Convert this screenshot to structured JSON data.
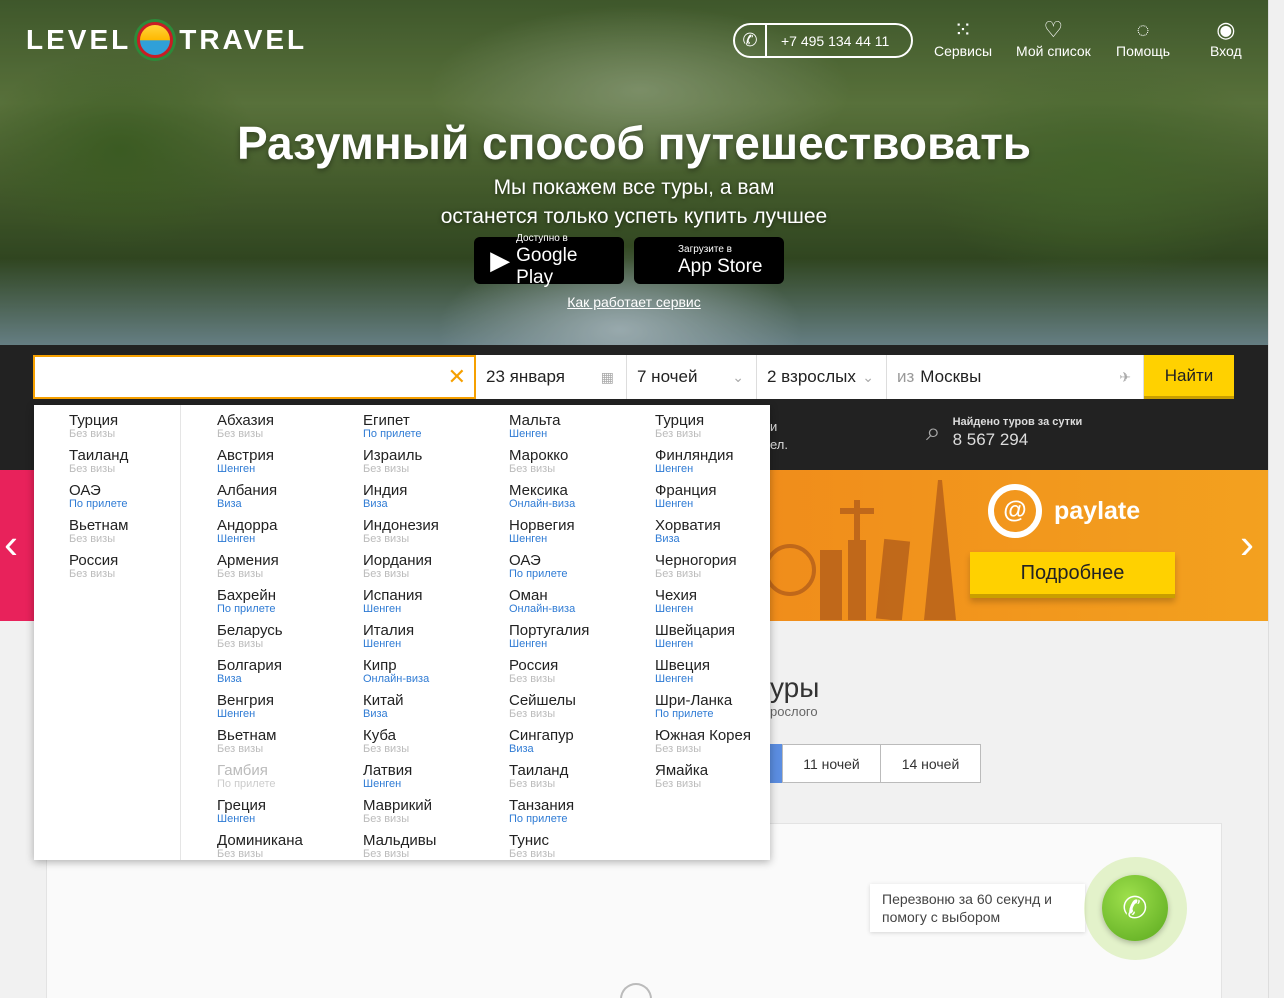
{
  "header": {
    "logo_left": "LEVEL",
    "logo_right": "TRAVEL",
    "phone": "+7 495 134 44 11",
    "nav": [
      {
        "label": "Сервисы",
        "icon": "grid-icon"
      },
      {
        "label": "Мой список",
        "icon": "heart-icon"
      },
      {
        "label": "Помощь",
        "icon": "lightbulb-icon"
      },
      {
        "label": "Вход",
        "icon": "user-icon"
      }
    ]
  },
  "hero": {
    "title": "Разумный способ путешествовать",
    "subtitle_line1": "Мы покажем все туры, а вам",
    "subtitle_line2": "останется только успеть купить лучшее",
    "google_small": "Доступно в",
    "google_big": "Google Play",
    "apple_small": "Загрузите в",
    "apple_big": "App Store",
    "how_link": "Как работает сервис"
  },
  "search": {
    "destination_value": "",
    "date": "23 января",
    "nights": "7 ночей",
    "guests": "2 взрослых",
    "from_prefix": "из",
    "from_city": "Москвы",
    "find_button": "Найти"
  },
  "stats": {
    "partial_line1": "и",
    "partial_line2": "ел.",
    "found_label": "Найдено туров за сутки",
    "found_value": "8 567 294"
  },
  "banner": {
    "brand": "paylate",
    "more_button": "Подробнее"
  },
  "section": {
    "title_partial": "уры",
    "subtitle_partial": "рослого",
    "nights_options": [
      "11 ночей",
      "14 ночей"
    ]
  },
  "callback": {
    "text": "Перезвоню за 60 секунд и помогу с выбором"
  },
  "colors": {
    "accent_yellow": "#ffd100",
    "border_orange": "#f6a000",
    "banner_pink": "#e8225b",
    "link_blue": "#2f7bd4"
  },
  "dropdown": {
    "popular": [
      {
        "name": "Турция",
        "visa": "Без визы"
      },
      {
        "name": "Таиланд",
        "visa": "Без визы"
      },
      {
        "name": "ОАЭ",
        "visa": "По прилете"
      },
      {
        "name": "Вьетнам",
        "visa": "Без визы"
      },
      {
        "name": "Россия",
        "visa": "Без визы"
      }
    ],
    "columns": [
      [
        {
          "name": "Абхазия",
          "visa": "Без визы"
        },
        {
          "name": "Австрия",
          "visa": "Шенген"
        },
        {
          "name": "Албания",
          "visa": "Виза"
        },
        {
          "name": "Андорра",
          "visa": "Шенген"
        },
        {
          "name": "Армения",
          "visa": "Без визы"
        },
        {
          "name": "Бахрейн",
          "visa": "По прилете"
        },
        {
          "name": "Беларусь",
          "visa": "Без визы"
        },
        {
          "name": "Болгария",
          "visa": "Виза"
        },
        {
          "name": "Венгрия",
          "visa": "Шенген"
        },
        {
          "name": "Вьетнам",
          "visa": "Без визы"
        },
        {
          "name": "Гамбия",
          "visa": "По прилете"
        },
        {
          "name": "Греция",
          "visa": "Шенген"
        },
        {
          "name": "Доминикана",
          "visa": "Без визы"
        }
      ],
      [
        {
          "name": "Египет",
          "visa": "По прилете"
        },
        {
          "name": "Израиль",
          "visa": "Без визы"
        },
        {
          "name": "Индия",
          "visa": "Виза"
        },
        {
          "name": "Индонезия",
          "visa": "Без визы"
        },
        {
          "name": "Иордания",
          "visa": "Без визы"
        },
        {
          "name": "Испания",
          "visa": "Шенген"
        },
        {
          "name": "Италия",
          "visa": "Шенген"
        },
        {
          "name": "Кипр",
          "visa": "Онлайн-виза"
        },
        {
          "name": "Китай",
          "visa": "Виза"
        },
        {
          "name": "Куба",
          "visa": "Без визы"
        },
        {
          "name": "Латвия",
          "visa": "Шенген"
        },
        {
          "name": "Маврикий",
          "visa": "Без визы"
        },
        {
          "name": "Мальдивы",
          "visa": "Без визы"
        }
      ],
      [
        {
          "name": "Мальта",
          "visa": "Шенген"
        },
        {
          "name": "Марокко",
          "visa": "Без визы"
        },
        {
          "name": "Мексика",
          "visa": "Онлайн-виза"
        },
        {
          "name": "Норвегия",
          "visa": "Шенген"
        },
        {
          "name": "ОАЭ",
          "visa": "По прилете"
        },
        {
          "name": "Оман",
          "visa": "Онлайн-виза"
        },
        {
          "name": "Португалия",
          "visa": "Шенген"
        },
        {
          "name": "Россия",
          "visa": "Без визы"
        },
        {
          "name": "Сейшелы",
          "visa": "Без визы"
        },
        {
          "name": "Сингапур",
          "visa": "Виза"
        },
        {
          "name": "Таиланд",
          "visa": "Без визы"
        },
        {
          "name": "Танзания",
          "visa": "По прилете"
        },
        {
          "name": "Тунис",
          "visa": "Без визы"
        }
      ],
      [
        {
          "name": "Турция",
          "visa": "Без визы"
        },
        {
          "name": "Финляндия",
          "visa": "Шенген"
        },
        {
          "name": "Франция",
          "visa": "Шенген"
        },
        {
          "name": "Хорватия",
          "visa": "Виза"
        },
        {
          "name": "Черногория",
          "visa": "Без визы"
        },
        {
          "name": "Чехия",
          "visa": "Шенген"
        },
        {
          "name": "Швейцария",
          "visa": "Шенген"
        },
        {
          "name": "Швеция",
          "visa": "Шенген"
        },
        {
          "name": "Шри-Ланка",
          "visa": "По прилете"
        },
        {
          "name": "Южная Корея",
          "visa": "Без визы"
        },
        {
          "name": "Ямайка",
          "visa": "Без визы"
        }
      ]
    ]
  }
}
